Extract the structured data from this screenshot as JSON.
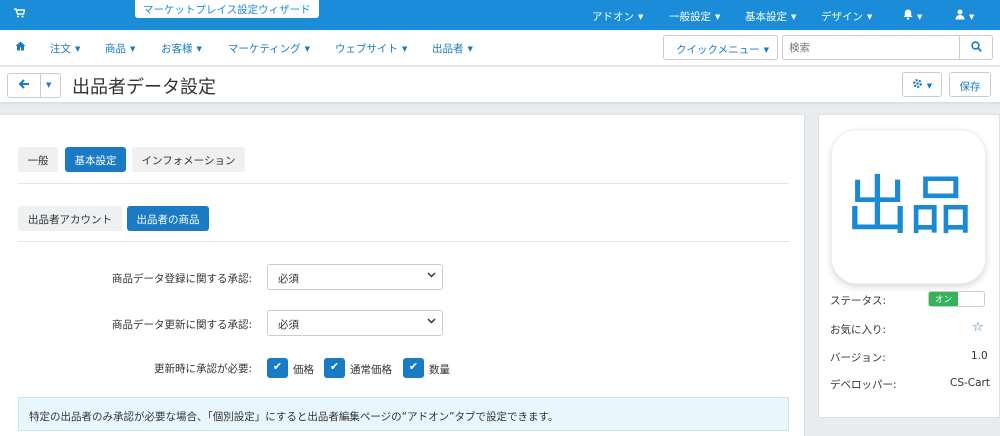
{
  "topbar": {
    "wizard_label": "マーケットプレイス設定ウィザード",
    "menus": [
      "アドオン",
      "一般設定",
      "基本設定",
      "デザイン"
    ]
  },
  "nav": {
    "items": [
      "注文",
      "商品",
      "お客様",
      "マーケティング",
      "ウェブサイト",
      "出品者"
    ],
    "quick_menu": "クイックメニュー",
    "search_placeholder": "検索"
  },
  "titlebar": {
    "title": "出品者データ設定",
    "save_label": "保存"
  },
  "tabs": [
    "一般",
    "基本設定",
    "インフォメーション"
  ],
  "subtabs": [
    "出品者アカウント",
    "出品者の商品"
  ],
  "form": {
    "field1_label": "商品データ登録に関する承認:",
    "field1_value": "必須",
    "field2_label": "商品データ更新に関する承認:",
    "field2_value": "必須",
    "field3_label": "更新時に承認が必要:",
    "checkboxes": [
      "価格",
      "通常価格",
      "数量"
    ]
  },
  "notice": "特定の出品者のみ承認が必要な場合、「個別設定」にすると出品者編集ページの“アドオン”タブで設定できます。",
  "addon": {
    "logo_text": "出品",
    "status_label": "ステータス:",
    "status_value": "オン",
    "favorite_label": "お気に入り:",
    "version_label": "バージョン:",
    "version_value": "1.0",
    "developer_label": "デベロッパー:",
    "developer_value": "CS-Cart"
  },
  "colors": {
    "primary": "#1a7ac4",
    "topbar": "#1a8cd8",
    "status_on": "#35b35a"
  }
}
